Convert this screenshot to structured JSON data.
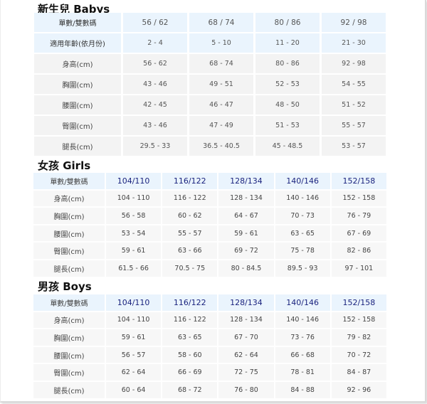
{
  "baby": {
    "title": "新生兒 Babys",
    "header": {
      "label": "單數/雙數碼",
      "sizes": [
        "56 / 62",
        "68 / 74",
        "80 / 86",
        "92 / 98"
      ]
    },
    "rows": [
      {
        "label": "適用年齡(依月份)",
        "values": [
          "2 - 4",
          "5 - 10",
          "11 - 20",
          "21 - 30"
        ]
      },
      {
        "label": "身高(cm)",
        "values": [
          "56 - 62",
          "68 - 74",
          "80 - 86",
          "92 - 98"
        ]
      },
      {
        "label": "胸圍(cm)",
        "values": [
          "43 - 46",
          "49 - 51",
          "52 - 53",
          "54 - 55"
        ]
      },
      {
        "label": "腰圍(cm)",
        "values": [
          "42 - 45",
          "46 - 47",
          "48 - 50",
          "51 - 52"
        ]
      },
      {
        "label": "臀圍(cm)",
        "values": [
          "43 - 46",
          "47 - 49",
          "51 - 53",
          "55 - 57"
        ]
      },
      {
        "label": "腿長(cm)",
        "values": [
          "29.5 - 33",
          "36.5 - 40.5",
          "45 - 48.5",
          "53 - 57"
        ]
      }
    ]
  },
  "girls": {
    "title": "女孩 Girls",
    "header": {
      "label": "單數/雙數碼",
      "sizes": [
        "104/110",
        "116/122",
        "128/134",
        "140/146",
        "152/158"
      ]
    },
    "rows": [
      {
        "label": "身高(cm)",
        "values": [
          "104 - 110",
          "116 - 122",
          "128 - 134",
          "140 - 146",
          "152 - 158"
        ]
      },
      {
        "label": "胸圍(cm)",
        "values": [
          "56 - 58",
          "60 - 62",
          "64 - 67",
          "70 - 73",
          "76 - 79"
        ]
      },
      {
        "label": "腰圍(cm)",
        "values": [
          "53 - 54",
          "55 - 57",
          "59 - 61",
          "63 - 65",
          "67 - 69"
        ]
      },
      {
        "label": "臀圍(cm)",
        "values": [
          "59 - 61",
          "63 - 66",
          "69 - 72",
          "75 - 78",
          "82 - 86"
        ]
      },
      {
        "label": "腿長(cm)",
        "values": [
          "61.5 - 66",
          "70.5 - 75",
          "80 - 84.5",
          "89.5 - 93",
          "97 - 101"
        ]
      }
    ]
  },
  "boys": {
    "title": "男孩 Boys",
    "header": {
      "label": "單數/雙數碼",
      "sizes": [
        "104/110",
        "116/122",
        "128/134",
        "140/146",
        "152/158"
      ]
    },
    "rows": [
      {
        "label": "身高(cm)",
        "values": [
          "104 - 110",
          "116 - 122",
          "128 - 134",
          "140 - 146",
          "152 - 158"
        ]
      },
      {
        "label": "胸圍(cm)",
        "values": [
          "59 - 61",
          "63 - 65",
          "67 - 70",
          "73 - 76",
          "79 - 82"
        ]
      },
      {
        "label": "腰圍(cm)",
        "values": [
          "56 - 57",
          "58 - 60",
          "62 - 64",
          "66 - 68",
          "70 - 72"
        ]
      },
      {
        "label": "臀圍(cm)",
        "values": [
          "62 - 64",
          "66 - 69",
          "72 - 75",
          "78 - 81",
          "84 - 87"
        ]
      },
      {
        "label": "腿長(cm)",
        "values": [
          "60 - 64",
          "68 - 72",
          "76 - 80",
          "84 - 88",
          "92 - 96"
        ]
      }
    ]
  },
  "colors": {
    "header_bg": "#eaf4fd",
    "baby_cell_bg": "#f3f3f3",
    "kid_cell_bg": "#f7f7f7",
    "kid_size_text": "#1a237e"
  }
}
